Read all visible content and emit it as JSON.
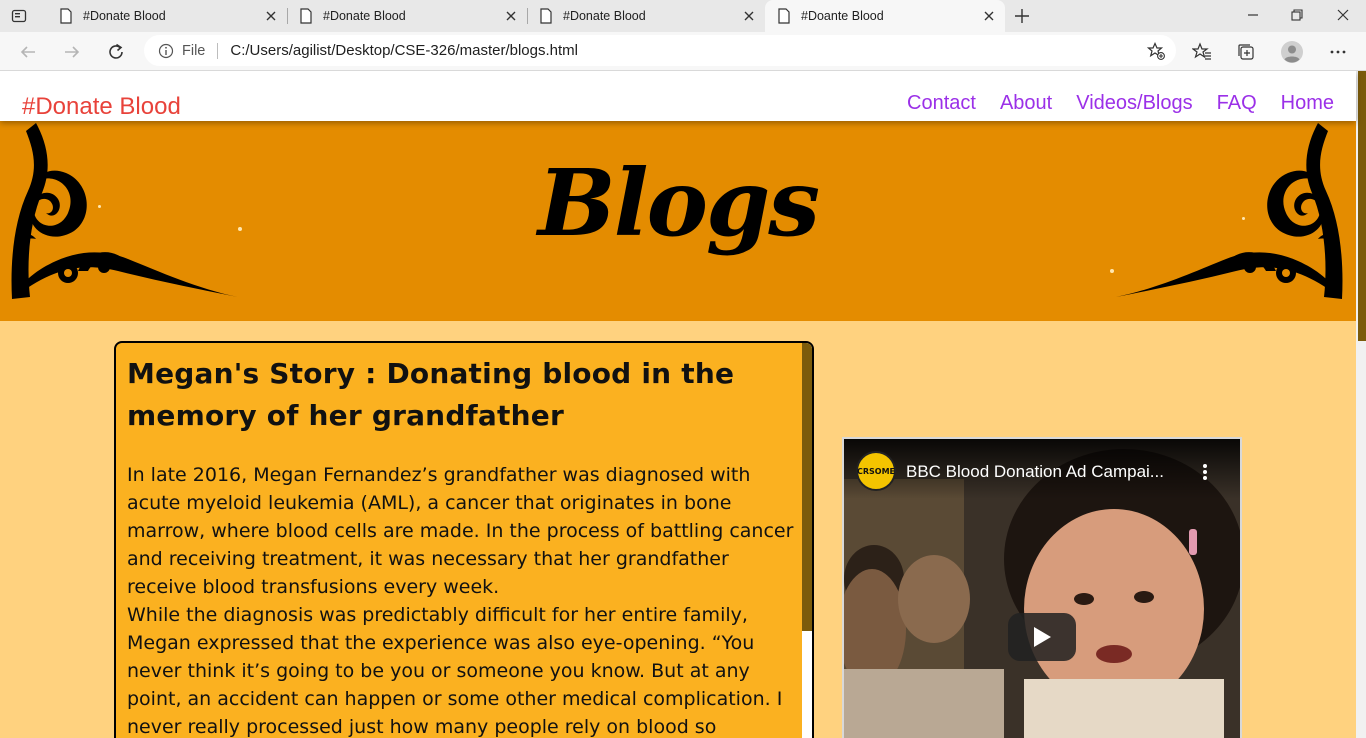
{
  "browser": {
    "tabs": [
      {
        "title": "#Donate Blood"
      },
      {
        "title": "#Donate Blood"
      },
      {
        "title": "#Donate Blood"
      },
      {
        "title": "#Doante Blood"
      }
    ],
    "address": {
      "scheme_label": "File",
      "url": "C:/Users/agilist/Desktop/CSE-326/master/blogs.html"
    }
  },
  "header": {
    "brand": "#Donate Blood",
    "nav": [
      "Contact",
      "About",
      "Videos/Blogs",
      "FAQ",
      "Home"
    ]
  },
  "banner": {
    "title": "Blogs"
  },
  "story": {
    "title": "Megan's Story : Donating blood in the memory of her grandfather",
    "paragraph1": "In late 2016, Megan Fernandez’s grandfather was diagnosed with acute myeloid leukemia (AML), a cancer that originates in bone marrow, where blood cells are made. In the process of battling cancer and receiving treatment, it was necessary that her grandfather receive blood transfusions every week.",
    "paragraph2": "While the diagnosis was predictably difficult for her entire family, Megan expressed that the experience was also eye-opening. “You never think it’s going to be you or someone you know. But at any point, an accident can happen or some other medical complication. I never really processed just how many people rely on blood so consistently, like my"
  },
  "video": {
    "channel_logo_text": "CRSOME",
    "title": "BBC Blood Donation Ad Campai..."
  },
  "colors": {
    "banner": "#e48c00",
    "page_bg": "#ffd27f",
    "card_bg": "#fbb120",
    "brand": "#e8423a",
    "nav": "#9b30e8"
  }
}
